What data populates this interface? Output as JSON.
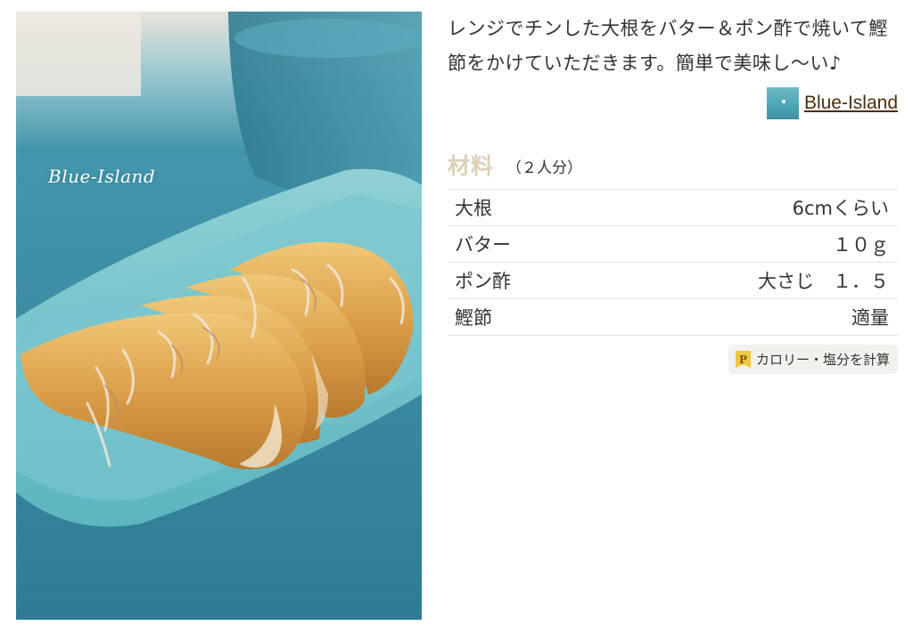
{
  "photo": {
    "watermark": "Blue-Island"
  },
  "recipe": {
    "description": "レンジでチンした大根をバター＆ポン酢で焼いて鰹節をかけていただきます。簡単で美味し〜い♪",
    "author": {
      "name": "Blue-Island",
      "link_color": "#4a2e0d"
    }
  },
  "ingredients": {
    "title": "材料",
    "servings": "（２人分）",
    "title_color": "#dccfb6",
    "items": [
      {
        "name": "大根",
        "amount": "6cmくらい"
      },
      {
        "name": "バター",
        "amount": "１０ｇ"
      },
      {
        "name": "ポン酢",
        "amount": "大さじ　１．５"
      },
      {
        "name": "鰹節",
        "amount": "適量"
      }
    ]
  },
  "calc": {
    "label": "カロリー・塩分を計算",
    "icon": "P",
    "icon_color": "#f0c73f"
  }
}
